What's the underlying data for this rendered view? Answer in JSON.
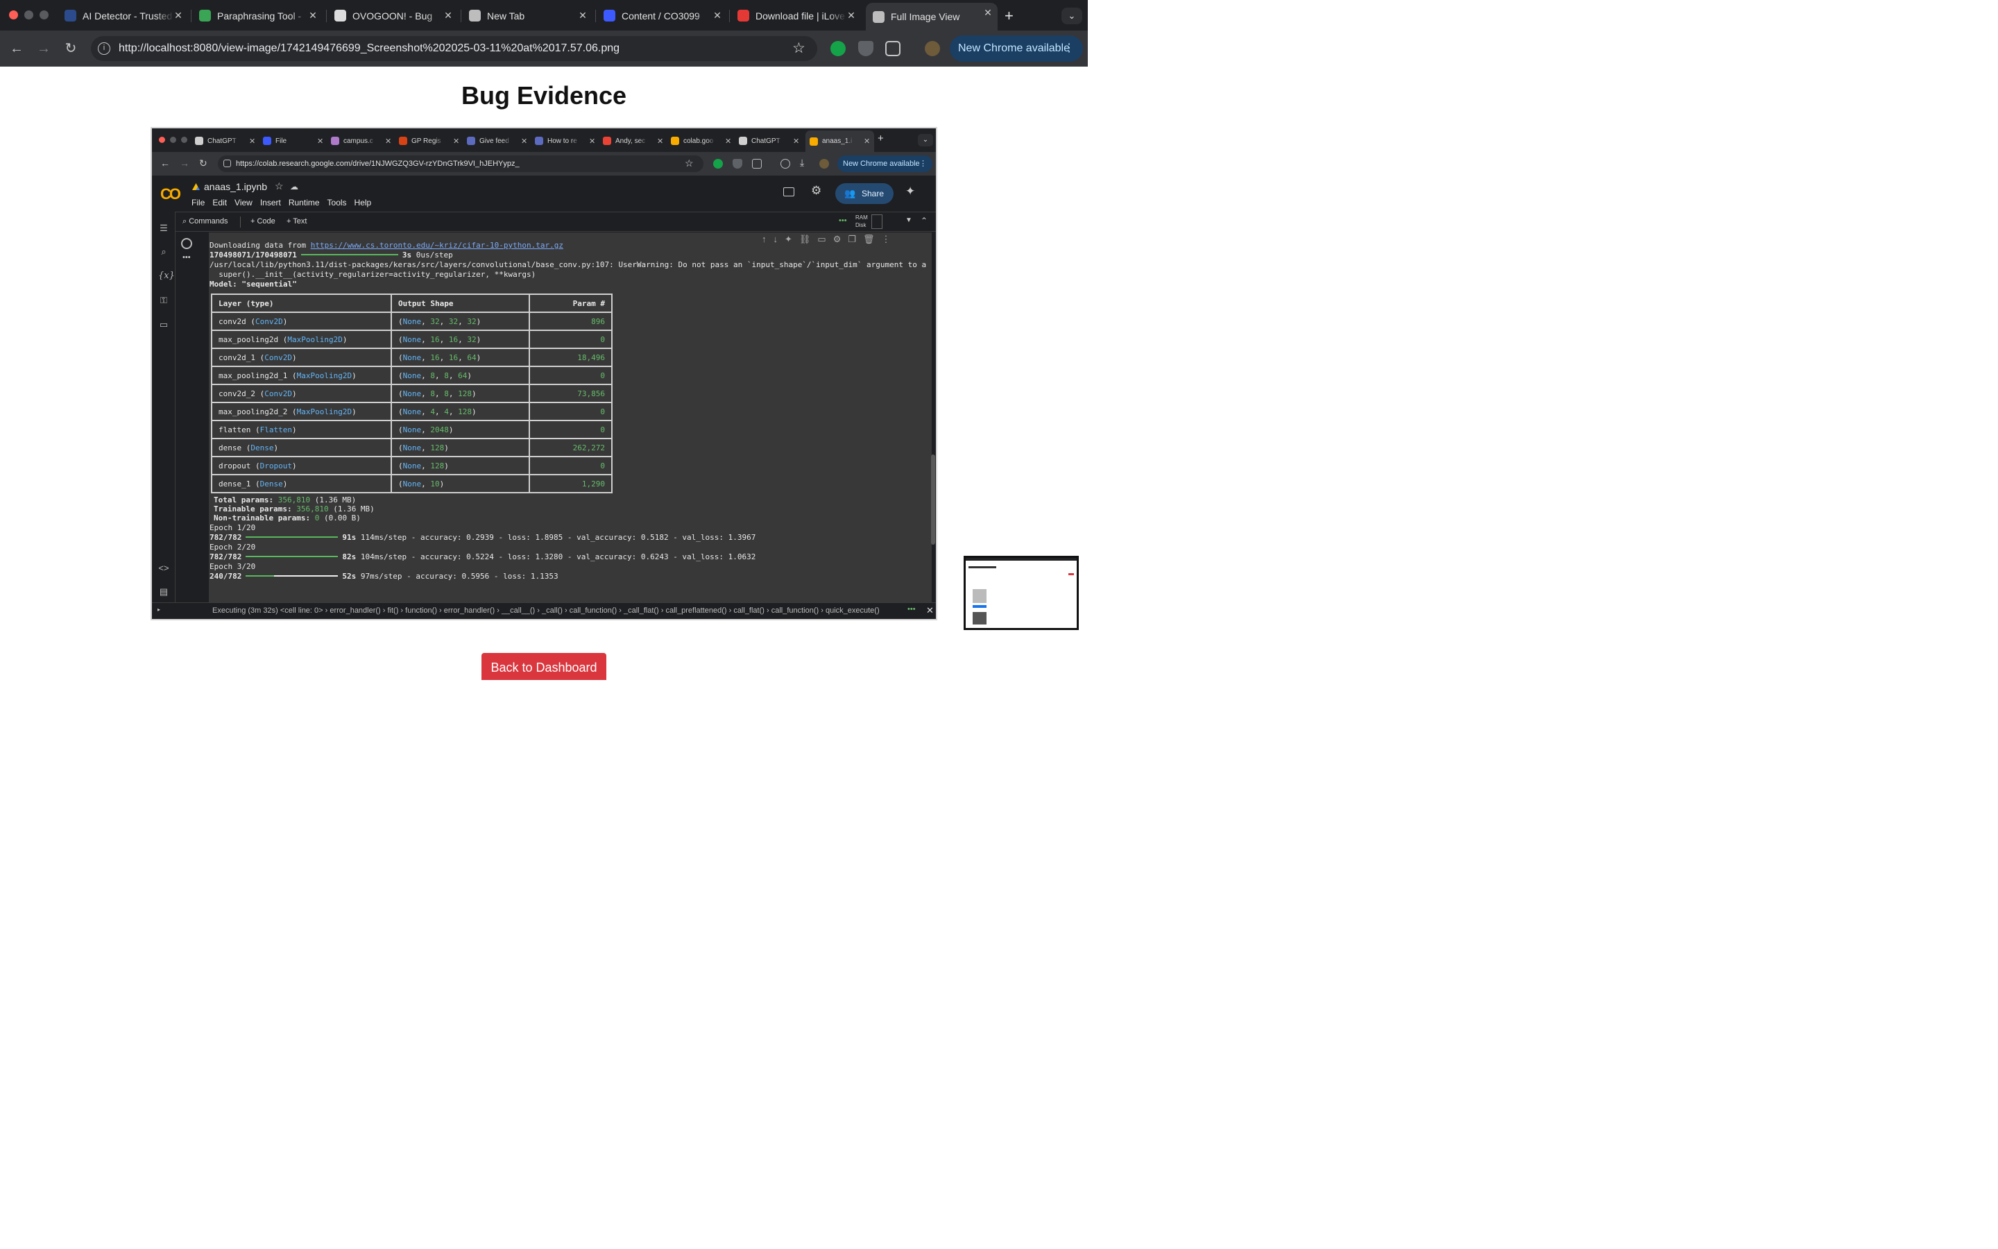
{
  "browser": {
    "tabs": [
      {
        "title": "AI Detector - Trusted",
        "icon": "ai-detector-icon",
        "color": "#2b4b8c"
      },
      {
        "title": "Paraphrasing Tool -",
        "icon": "paraphrase-icon",
        "color": "#3aa655"
      },
      {
        "title": "OVOGOON! - Bug",
        "icon": "openai-icon",
        "color": "#dcdcdc"
      },
      {
        "title": "New Tab",
        "icon": "chrome-icon",
        "color": "#bdbdbd"
      },
      {
        "title": "Content / CO3099",
        "icon": "content-icon",
        "color": "#3d5afe"
      },
      {
        "title": "Download file | iLove",
        "icon": "heart-icon",
        "color": "#e53935"
      },
      {
        "title": "Full Image View",
        "icon": "globe-icon",
        "color": "#bdbdbd"
      }
    ],
    "new_tab": "+",
    "close": "✕",
    "url": "http://localhost:8080/view-image/1742149476699_Screenshot%202025-03-11%20at%2017.57.06.png",
    "new_chrome": "New Chrome available"
  },
  "page": {
    "title": "Bug Evidence",
    "back_button": "Back to Dashboard"
  },
  "inner": {
    "tabs": [
      {
        "title": "ChatGPT",
        "color": "#cfcfcf"
      },
      {
        "title": "File",
        "color": "#3d5afe"
      },
      {
        "title": "campus.c",
        "color": "#b07acb"
      },
      {
        "title": "GP Regis",
        "color": "#d84315"
      },
      {
        "title": "Give feed",
        "color": "#5c6bc0"
      },
      {
        "title": "How to re",
        "color": "#5c6bc0"
      },
      {
        "title": "Andy, sec",
        "color": "#ea4335"
      },
      {
        "title": "colab.goo",
        "color": "#f9ab00"
      },
      {
        "title": "ChatGPT",
        "color": "#cfcfcf"
      },
      {
        "title": "anaas_1.i",
        "color": "#f9ab00"
      }
    ],
    "url": "https://colab.research.google.com/drive/1NJWGZQ3GV-rzYDnGTrk9VI_hJEHYypz_",
    "new_chrome": "New Chrome available",
    "notebook": "anaas_1.ipynb",
    "menu": [
      "File",
      "Edit",
      "View",
      "Insert",
      "Runtime",
      "Tools",
      "Help"
    ],
    "share": "Share",
    "commands": "Commands",
    "code": "+ Code",
    "text": "+ Text",
    "ram": "RAM",
    "disk": "Disk"
  },
  "output": {
    "download_prefix": "Downloading data from ",
    "download_url": "https://www.cs.toronto.edu/~kriz/cifar-10-python.tar.gz",
    "progress_count": "170498071/170498071",
    "progress_time": "3s",
    "progress_rate": " 0us/step",
    "warning": "/usr/local/lib/python3.11/dist-packages/keras/src/layers/convolutional/base_conv.py:107: UserWarning: Do not pass an `input_shape`/`input_dim` argument to a",
    "warning2": "  super().__init__(activity_regularizer=activity_regularizer, **kwargs)",
    "model": "Model: \"sequential\"",
    "headers": [
      "Layer (type)",
      "Output Shape",
      "Param #"
    ],
    "rows": [
      {
        "name": "conv2d",
        "type": "Conv2D",
        "shape": [
          "None",
          "32",
          "32",
          "32"
        ],
        "params": "896"
      },
      {
        "name": "max_pooling2d",
        "type": "MaxPooling2D",
        "shape": [
          "None",
          "16",
          "16",
          "32"
        ],
        "params": "0"
      },
      {
        "name": "conv2d_1",
        "type": "Conv2D",
        "shape": [
          "None",
          "16",
          "16",
          "64"
        ],
        "params": "18,496"
      },
      {
        "name": "max_pooling2d_1",
        "type": "MaxPooling2D",
        "shape": [
          "None",
          "8",
          "8",
          "64"
        ],
        "params": "0"
      },
      {
        "name": "conv2d_2",
        "type": "Conv2D",
        "shape": [
          "None",
          "8",
          "8",
          "128"
        ],
        "params": "73,856"
      },
      {
        "name": "max_pooling2d_2",
        "type": "MaxPooling2D",
        "shape": [
          "None",
          "4",
          "4",
          "128"
        ],
        "params": "0"
      },
      {
        "name": "flatten",
        "type": "Flatten",
        "shape": [
          "None",
          "2048"
        ],
        "params": "0"
      },
      {
        "name": "dense",
        "type": "Dense",
        "shape": [
          "None",
          "128"
        ],
        "params": "262,272"
      },
      {
        "name": "dropout",
        "type": "Dropout",
        "shape": [
          "None",
          "128"
        ],
        "params": "0"
      },
      {
        "name": "dense_1",
        "type": "Dense",
        "shape": [
          "None",
          "10"
        ],
        "params": "1,290"
      }
    ],
    "total_label": "Total params:",
    "total_value": "356,810",
    "total_size": " (1.36 MB)",
    "trainable_label": "Trainable params:",
    "trainable_value": "356,810",
    "trainable_size": " (1.36 MB)",
    "nontrainable_label": "Non-trainable params:",
    "nontrainable_value": "0",
    "nontrainable_size": " (0.00 B)",
    "epochs": [
      {
        "label": "Epoch 1/20",
        "count": "782/782",
        "progress": 1.0,
        "time": "91s",
        "rest": " 114ms/step - accuracy: 0.2939 - loss: 1.8985 - val_accuracy: 0.5182 - val_loss: 1.3967"
      },
      {
        "label": "Epoch 2/20",
        "count": "782/782",
        "progress": 1.0,
        "time": "82s",
        "rest": " 104ms/step - accuracy: 0.5224 - loss: 1.3280 - val_accuracy: 0.6243 - val_loss: 1.0632"
      },
      {
        "label": "Epoch 3/20",
        "count": "240/782",
        "progress": 0.307,
        "time": "52s",
        "rest": " 97ms/step - accuracy: 0.5956 - loss: 1.1353"
      }
    ]
  },
  "status": "Executing (3m 32s)  <cell line: 0> › error_handler() › fit() › function() › error_handler() › __call__() › _call() › call_function() › _call_flat() › call_preflattened() › call_flat() › call_function() › quick_execute()"
}
